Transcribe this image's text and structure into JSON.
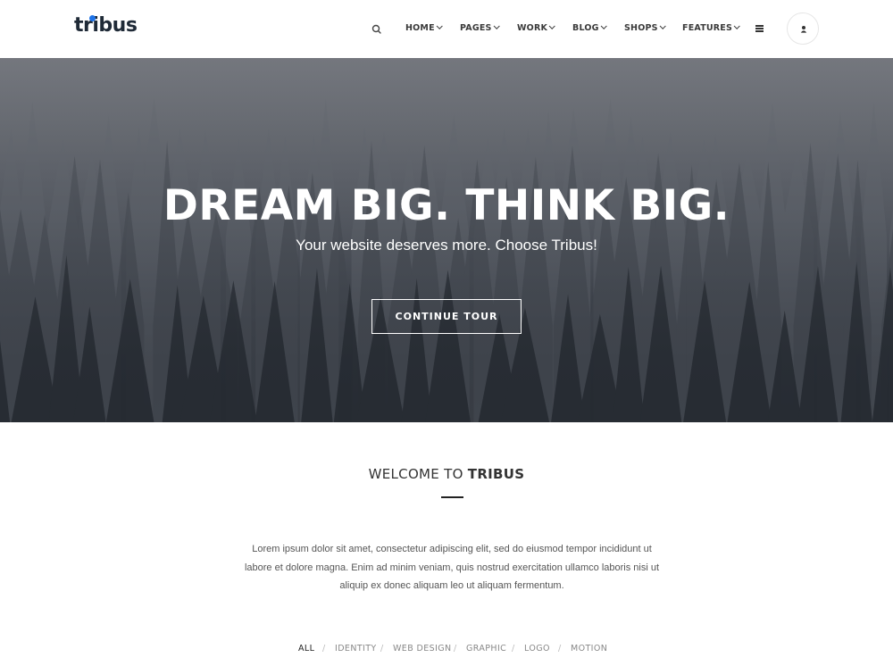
{
  "brand": {
    "name": "tribus",
    "accent": "#1e73e8"
  },
  "header": {
    "nav": [
      {
        "label": "HOME"
      },
      {
        "label": "PAGES"
      },
      {
        "label": "WORK"
      },
      {
        "label": "BLOG"
      },
      {
        "label": "SHOPS"
      },
      {
        "label": "FEATURES"
      }
    ],
    "icons": {
      "search": "search-icon",
      "menu": "hamburger-icon",
      "user": "user-icon"
    }
  },
  "hero": {
    "title": "DREAM BIG. THINK BIG.",
    "subtitle": "Your website deserves more. Choose Tribus!",
    "cta_label": "CONTINUE TOUR"
  },
  "welcome": {
    "title_light": "WELCOME TO",
    "title_strong": "TRIBUS",
    "body": "Lorem ipsum dolor sit amet, consectetur adipiscing elit, sed do eiusmod tempor incididunt ut labore et dolore magna. Enim ad minim veniam, quis nostrud exercitation ullamco laboris nisi ut aliquip ex donec aliquam leo ut aliquam fermentum."
  },
  "filters": {
    "separator": "/",
    "items": [
      {
        "label": "ALL",
        "active": true
      },
      {
        "label": "IDENTITY",
        "active": false
      },
      {
        "label": "WEB DESIGN",
        "active": false
      },
      {
        "label": "GRAPHIC",
        "active": false
      },
      {
        "label": "LOGO",
        "active": false
      },
      {
        "label": "MOTION",
        "active": false
      }
    ]
  }
}
